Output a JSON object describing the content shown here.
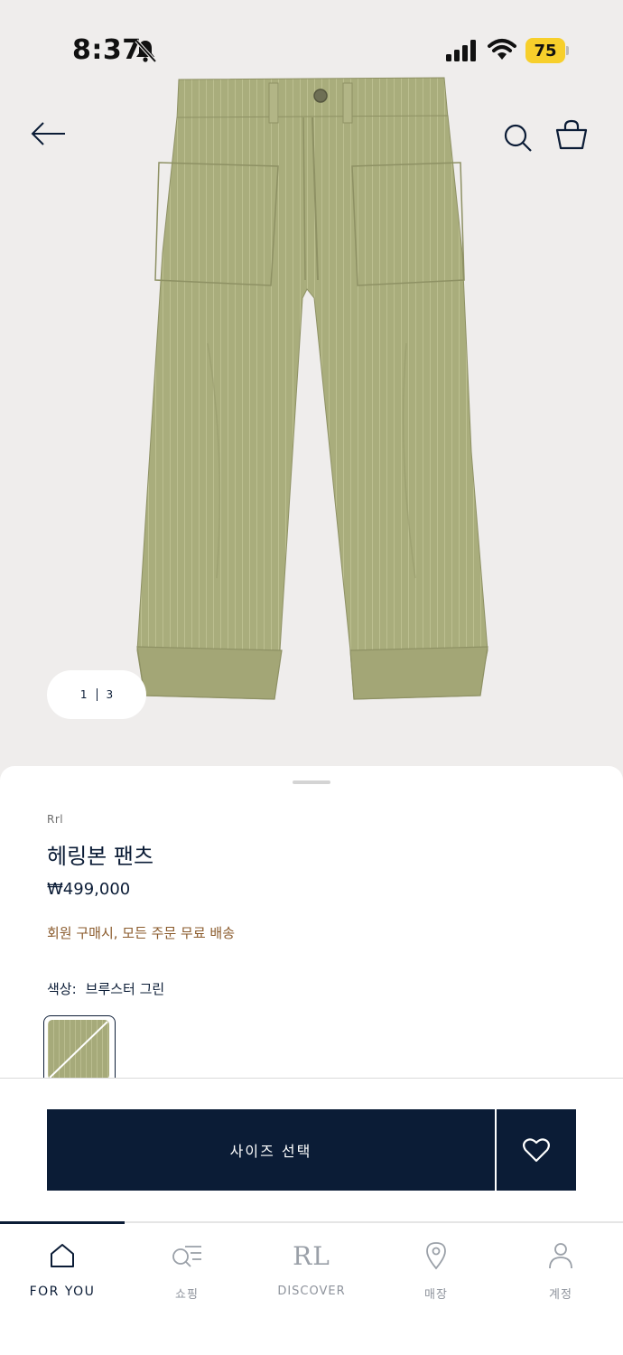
{
  "status_bar": {
    "time": "8:37",
    "battery": "75"
  },
  "gallery": {
    "current": "1",
    "total": "3"
  },
  "product": {
    "brand": "Rrl",
    "title": "헤링본 팬츠",
    "price": "₩499,000",
    "promo": "회원 구매시, 모든 주문 무료 배송",
    "color_label": "색상:",
    "color_value": "브루스터 그린"
  },
  "actions": {
    "select_size": "사이즈 선택"
  },
  "tabs": [
    {
      "label": "FOR YOU",
      "icon": "home-icon"
    },
    {
      "label": "쇼핑",
      "icon": "shop-search-icon"
    },
    {
      "label": "DISCOVER",
      "logo": "RL"
    },
    {
      "label": "매장",
      "icon": "location-pin-icon"
    },
    {
      "label": "계정",
      "icon": "person-icon"
    }
  ],
  "colors": {
    "navy": "#0b1c36",
    "promo": "#8a5a2b",
    "battery": "#f7cf2b",
    "hero_bg": "#efedec",
    "pants": "#a9ad7c"
  }
}
